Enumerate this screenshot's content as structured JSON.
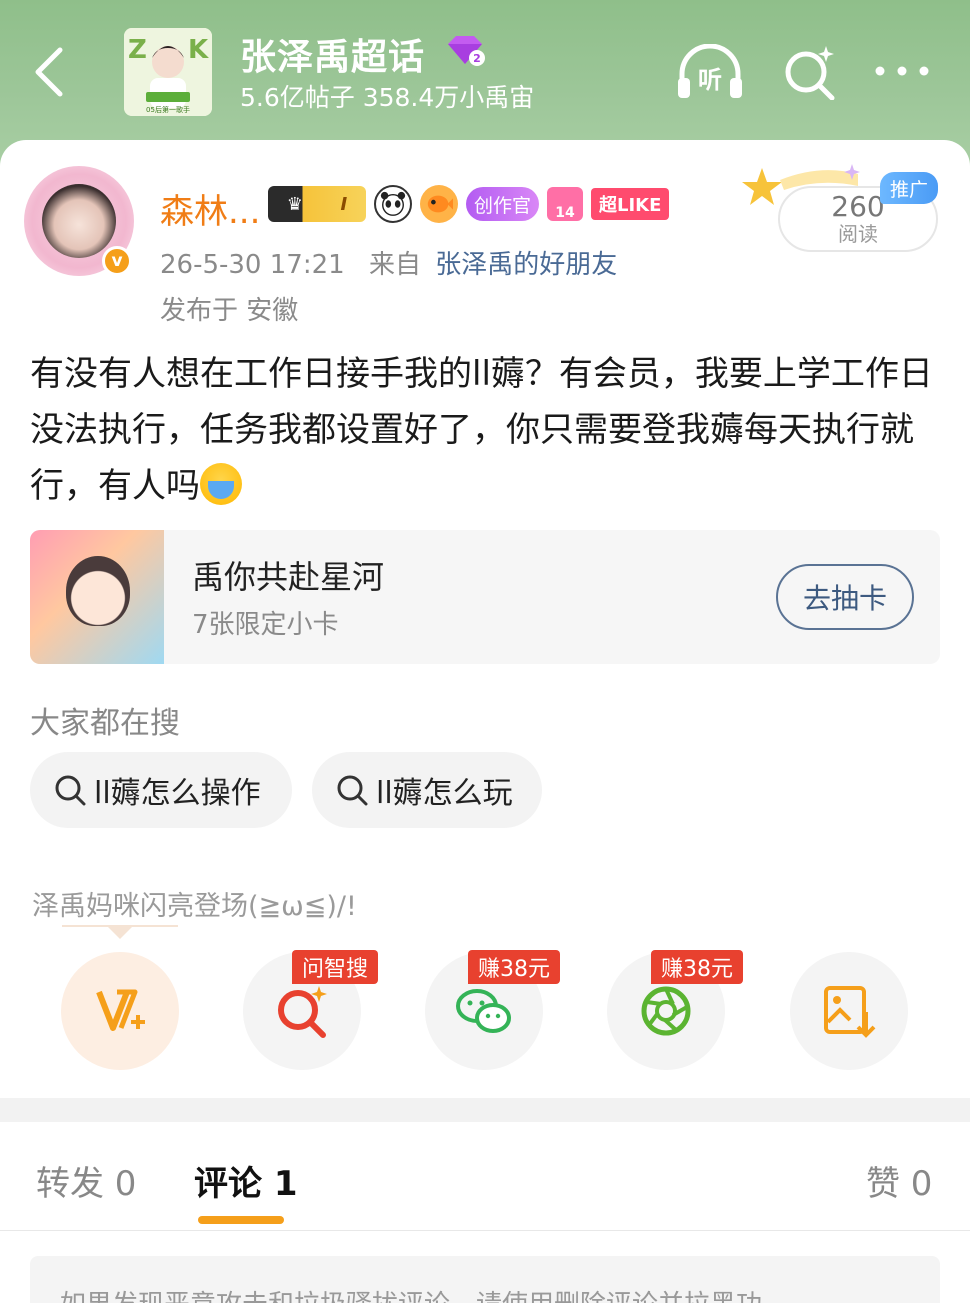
{
  "header": {
    "topic_title": "张泽禹超话",
    "topic_level": "2",
    "topic_stats": "5.6亿帖子 358.4万小禹宙",
    "cover_caption": "05后第一歌手",
    "listen_label": "听"
  },
  "post": {
    "username": "森林...",
    "badges": {
      "vip_level": "I",
      "creator": "创作官",
      "gem_level": "14",
      "super_like": "超LIKE"
    },
    "verified_mark": "v",
    "timestamp": "26-5-30 17:21",
    "from_label": "来自",
    "source": "张泽禹的好朋友",
    "location": "发布于 安徽",
    "read_count": "260",
    "read_label": "阅读",
    "promo_tag": "推广",
    "text": "有没有人想在工作日接手我的ll薅？有会员，我要上学工作日没法执行，任务我都设置好了，你只需要登我薅每天执行就行，有人吗"
  },
  "draw_card": {
    "title": "禹你共赴星河",
    "subtitle": "7张限定小卡",
    "button": "去抽卡"
  },
  "search": {
    "heading": "大家都在搜",
    "chips": [
      "ll薅怎么操作",
      "ll薅怎么玩"
    ]
  },
  "share": {
    "prompt": "泽禹妈咪闪亮登场(≧ω≦)/!",
    "tags": [
      "问智搜",
      "赚38元",
      "赚38元"
    ]
  },
  "tabs": {
    "repost": "转发 0",
    "comment": "评论 1",
    "like": "赞 0"
  },
  "notice": "如果发现恶意攻击和垃圾骚扰评论，请使用删除评论并拉黑功"
}
